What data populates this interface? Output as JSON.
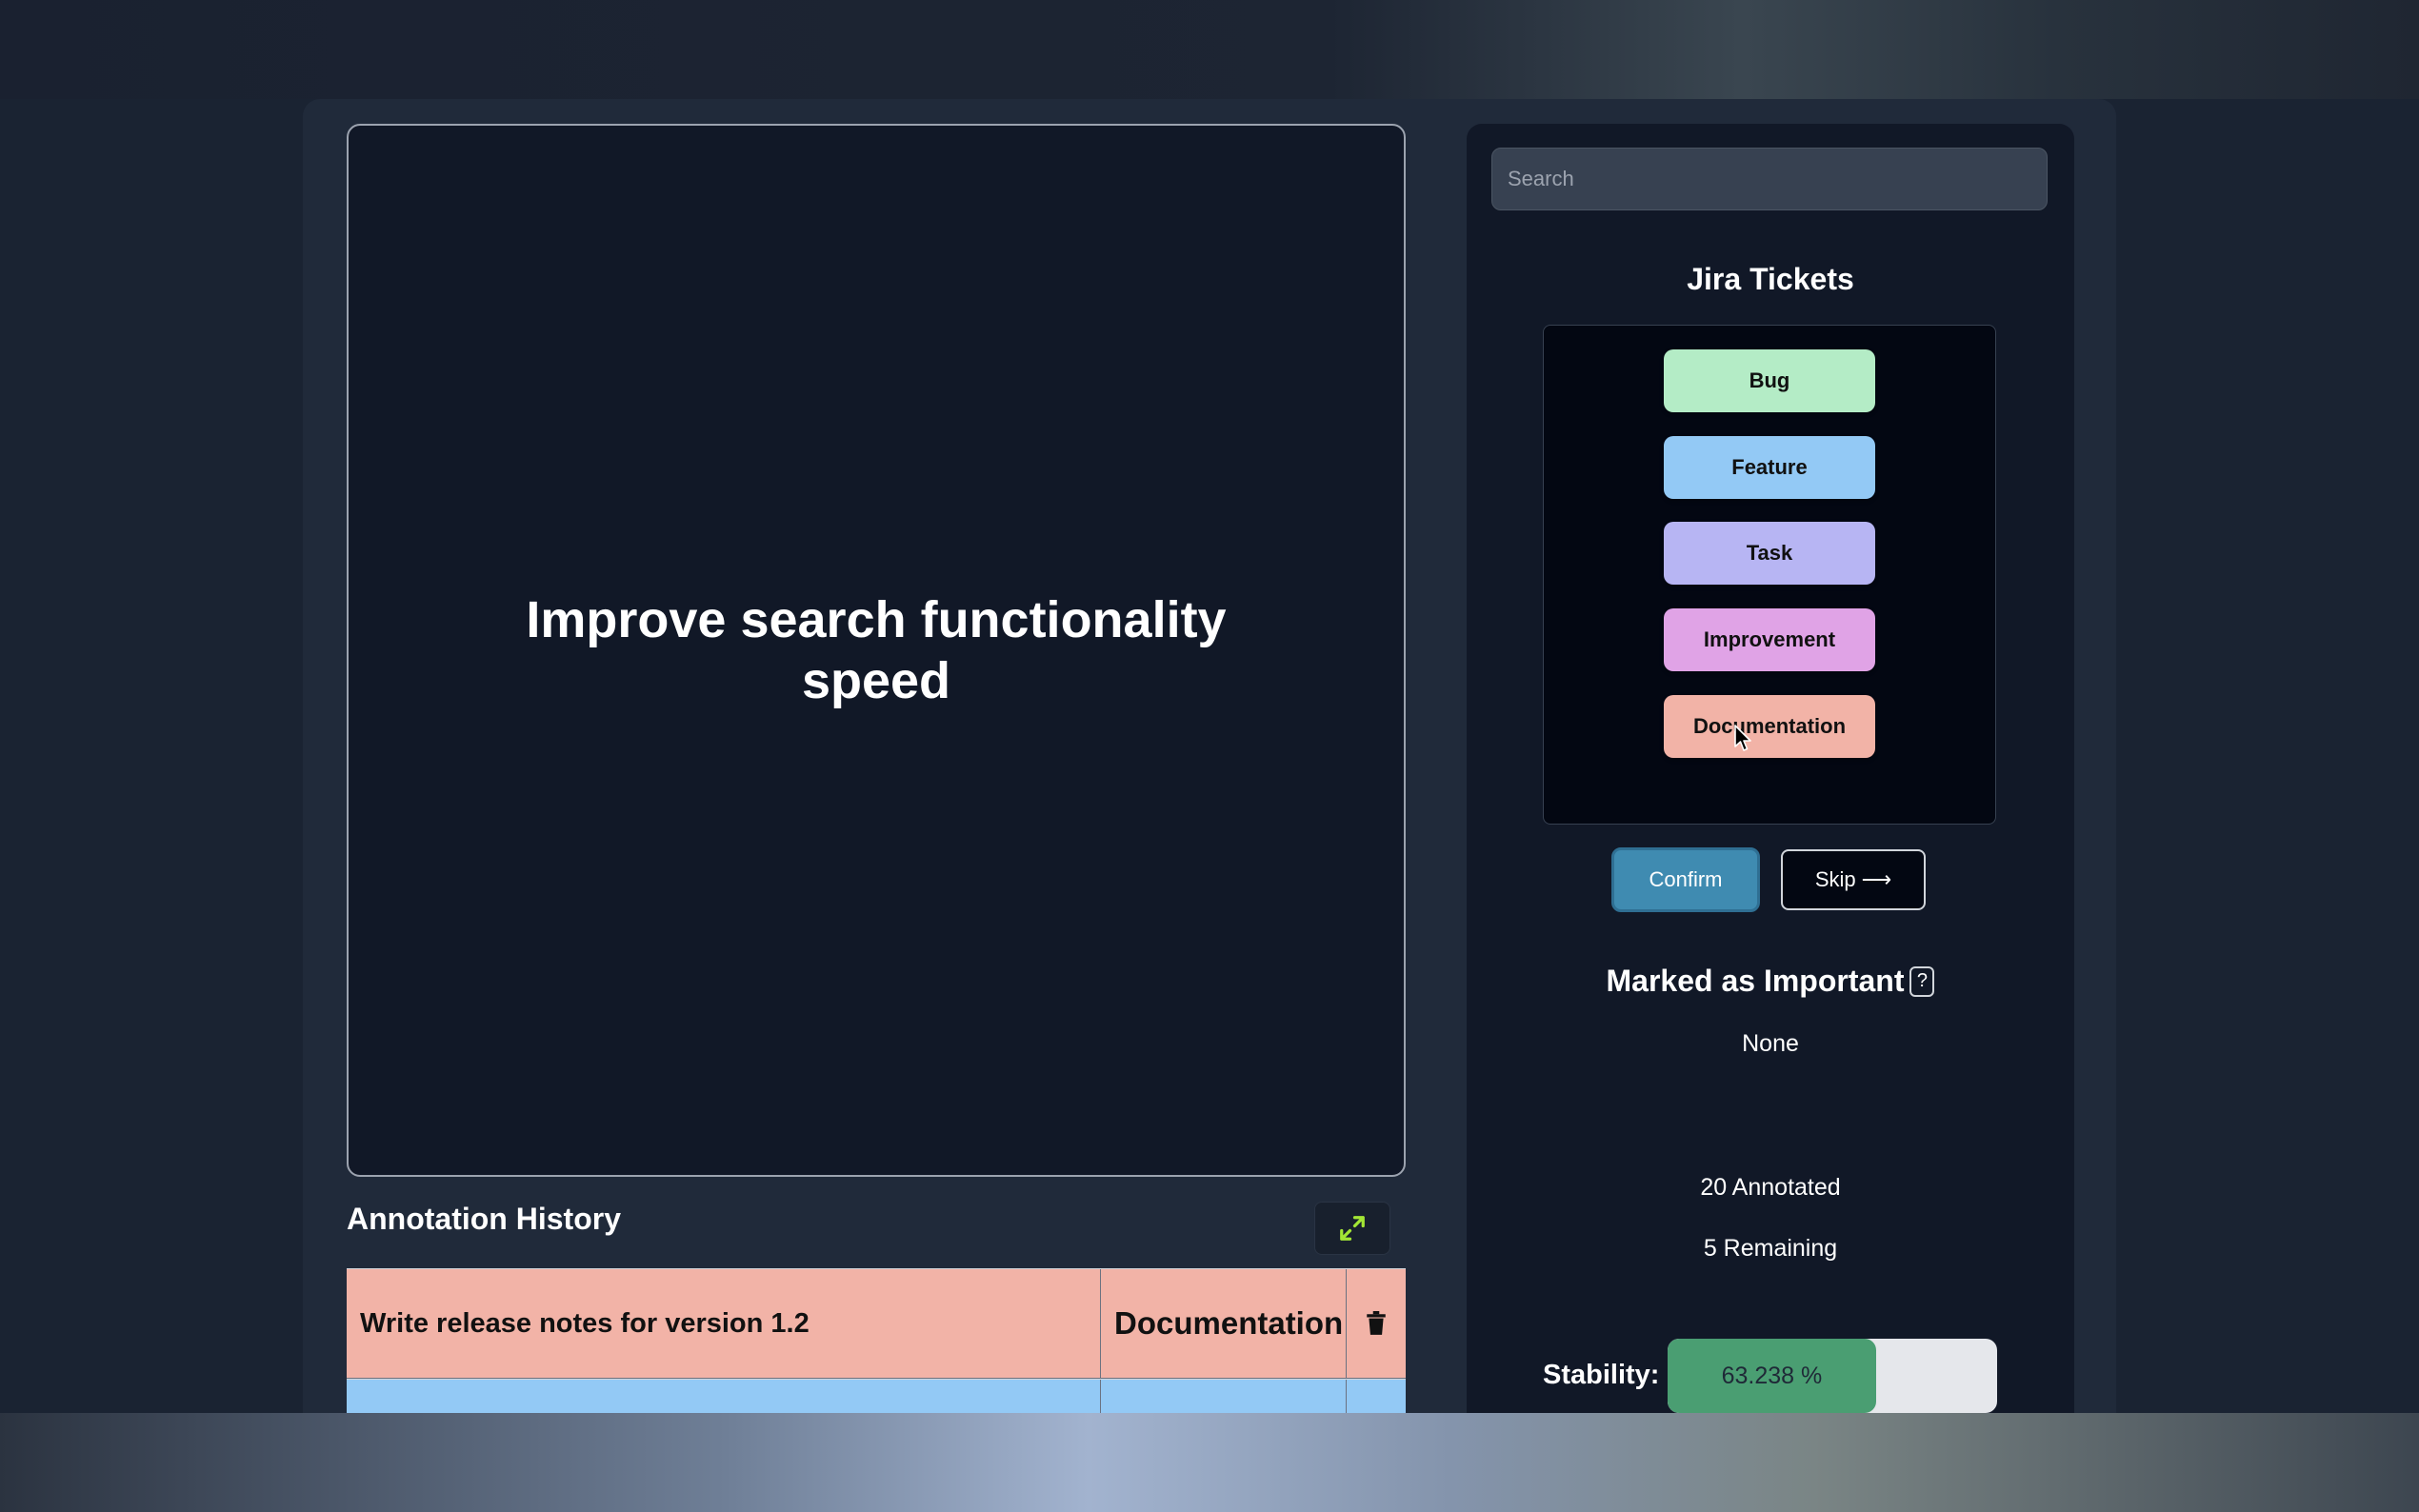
{
  "main": {
    "current_item_title": "Improve search functionality speed"
  },
  "history": {
    "title": "Annotation History",
    "rows": [
      {
        "title": "Write release notes for version 1.2",
        "label": "Documentation",
        "color": "#f2b3a7"
      },
      {
        "title": "",
        "label": "",
        "color": "#93c9f5"
      }
    ]
  },
  "sidebar": {
    "search_placeholder": "Search",
    "label_group_title": "Jira Tickets",
    "labels": [
      {
        "name": "Bug",
        "color": "#b4ecc6"
      },
      {
        "name": "Feature",
        "color": "#93c9f5"
      },
      {
        "name": "Task",
        "color": "#b7b5f3"
      },
      {
        "name": "Improvement",
        "color": "#e0a3e6"
      },
      {
        "name": "Documentation",
        "color": "#f2b3a7"
      }
    ],
    "confirm_label": "Confirm",
    "skip_label": "Skip",
    "skip_arrow": "⟶",
    "important_title": "Marked as Important",
    "help_glyph": "?",
    "important_value": "None",
    "annotated_text": "20 Annotated",
    "remaining_text": "5 Remaining",
    "stability_label": "Stability:",
    "stability_value_text": "63.238 %",
    "stability_fraction": 0.63238
  },
  "colors": {
    "accent": "#3f8bb1",
    "stability_fill": "#4a9e72",
    "expand_icon": "#a3e635"
  }
}
